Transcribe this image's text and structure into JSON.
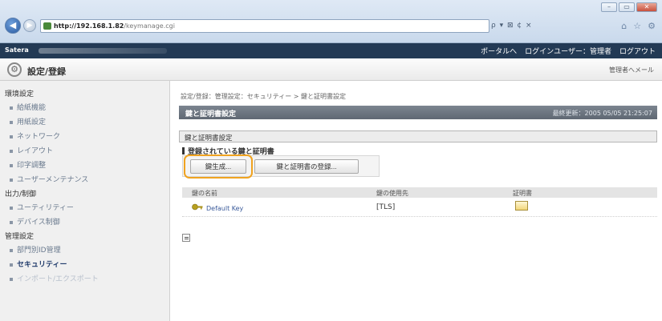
{
  "browser": {
    "url_host": "http://192.168.1.82",
    "url_path": "/keymanage.cgi",
    "address_tools": "ρ ▾ ⊠ ¢ ×",
    "window_controls": [
      "–",
      "▭",
      "✕"
    ],
    "icons": [
      "home-icon",
      "star-icon",
      "gear-icon"
    ]
  },
  "topbar": {
    "brand": "Satera",
    "portal_link": "ポータルへ",
    "login_user": "ログインユーザー：管理者",
    "logout": "ログアウト"
  },
  "titlebar": {
    "title": "設定/登録",
    "mail_link": "管理者へメール"
  },
  "sidebar": {
    "sections": [
      {
        "label": "環境設定"
      },
      {
        "label": "出力/制御"
      },
      {
        "label": "管理設定"
      }
    ],
    "items": [
      {
        "label": "給紙機能"
      },
      {
        "label": "用紙設定"
      },
      {
        "label": "ネットワーク"
      },
      {
        "label": "レイアウト"
      },
      {
        "label": "印字調整"
      },
      {
        "label": "ユーザーメンテナンス"
      },
      {
        "label": "ユーティリティー"
      },
      {
        "label": "デバイス制御"
      },
      {
        "label": "部門別ID管理"
      },
      {
        "label": "セキュリティー"
      },
      {
        "label": "インポート/エクスポート"
      }
    ]
  },
  "main": {
    "breadcrumb": "設定/登録：管理設定：セキュリティー > 鍵と証明書設定",
    "page_title": "鍵と証明書設定",
    "last_updated": "最終更新：2005 05/05 21:25:07",
    "section_title": "鍵と証明書設定",
    "subhead": "登録されている鍵と証明書",
    "buttons": {
      "generate": "鍵生成...",
      "register": "鍵と証明書の登録..."
    },
    "table": {
      "columns": [
        "鍵の名前",
        "鍵の使用先",
        "証明書"
      ],
      "rows": [
        {
          "name": "Default Key",
          "use": "[TLS]"
        }
      ]
    }
  },
  "colors": {
    "highlight": "#f0a320",
    "header_bar": "#233a55",
    "page_head": "#6b7480"
  }
}
